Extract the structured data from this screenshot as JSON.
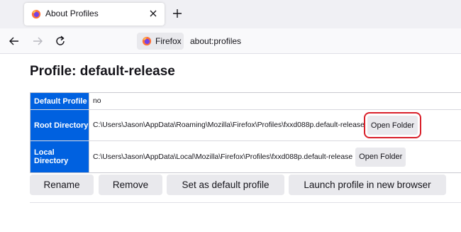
{
  "tab": {
    "title": "About Profiles",
    "close_icon": "close-icon",
    "favicon": "firefox-icon"
  },
  "navbar": {
    "identity_label": "Firefox",
    "url": "about:profiles"
  },
  "page": {
    "title": "Profile: default-release",
    "rows": [
      {
        "label": "Default Profile",
        "value": "no"
      },
      {
        "label": "Root Directory",
        "value": "C:\\Users\\Jason\\AppData\\Roaming\\Mozilla\\Firefox\\Profiles\\fxxd088p.default-release",
        "button": "Open Folder"
      },
      {
        "label": "Local Directory",
        "value": "C:\\Users\\Jason\\AppData\\Local\\Mozilla\\Firefox\\Profiles\\fxxd088p.default-release",
        "button": "Open Folder"
      }
    ],
    "actions": {
      "rename": "Rename",
      "remove": "Remove",
      "set_default": "Set as default profile",
      "launch": "Launch profile in new browser"
    }
  },
  "colors": {
    "accent": "#0061e0",
    "highlight": "#d9202a"
  }
}
